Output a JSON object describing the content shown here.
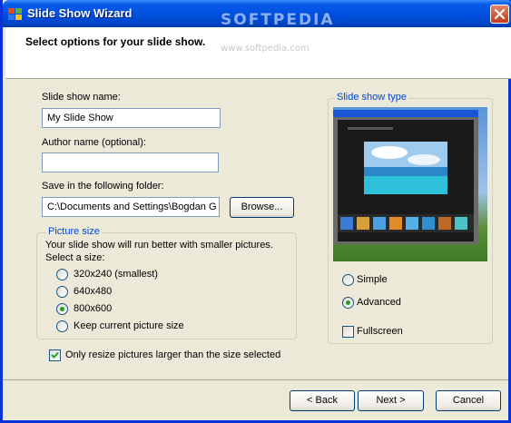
{
  "window": {
    "title": "Slide Show Wizard",
    "watermark": "SOFTPEDIA",
    "watermark_sub": "www.softpedia.com"
  },
  "header": {
    "title": "Select options for your slide show."
  },
  "form": {
    "name_label": "Slide show name:",
    "name_value": "My Slide Show",
    "author_label": "Author name (optional):",
    "author_value": "",
    "folder_label": "Save in the following folder:",
    "folder_value": "C:\\Documents and Settings\\Bogdan G",
    "browse_label": "Browse..."
  },
  "picture_size": {
    "title": "Picture size",
    "hint": "Your slide show will run better with smaller pictures.",
    "select_label": "Select a size:",
    "options": [
      "320x240 (smallest)",
      "640x480",
      "800x600",
      "Keep current picture size"
    ],
    "selected": "800x600"
  },
  "resize_checkbox": {
    "label": "Only resize pictures larger than the size selected",
    "checked": true
  },
  "slide_show_type": {
    "title": "Slide show type",
    "options": [
      "Simple",
      "Advanced"
    ],
    "selected": "Advanced",
    "fullscreen_label": "Fullscreen",
    "fullscreen_checked": false
  },
  "footer": {
    "back_label": "< Back",
    "next_label": "Next >",
    "cancel_label": "Cancel"
  },
  "colors": {
    "titlebar": "#0054e3",
    "dialog_bg": "#ece9d8",
    "group_title": "#0046d5",
    "radio_dot": "#21a121"
  }
}
